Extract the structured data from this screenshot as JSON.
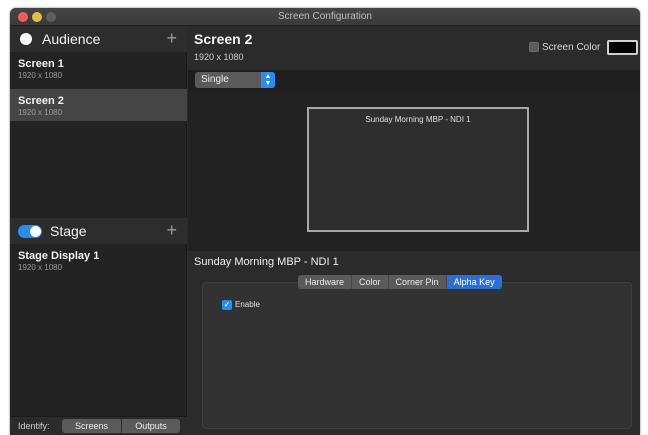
{
  "window": {
    "title": "Screen Configuration"
  },
  "sidebar": {
    "audience": {
      "title": "Audience",
      "items": [
        {
          "name": "Screen 1",
          "resolution": "1920 x 1080"
        },
        {
          "name": "Screen 2",
          "resolution": "1920 x 1080"
        }
      ]
    },
    "stage": {
      "title": "Stage",
      "items": [
        {
          "name": "Stage Display 1",
          "resolution": "1920 x 1080"
        }
      ]
    },
    "identify": {
      "label": "Identify:",
      "screens": "Screens",
      "outputs": "Outputs"
    }
  },
  "main": {
    "title": "Screen 2",
    "resolution": "1920 x 1080",
    "screen_color_label": "Screen Color",
    "screen_color_value": "#000000",
    "mode": "Single",
    "preview_label": "Sunday Morning MBP - NDI 1",
    "output_title": "Sunday Morning MBP - NDI 1",
    "tabs": [
      "Hardware",
      "Color",
      "Corner Pin",
      "Alpha Key"
    ],
    "active_tab": "Alpha Key",
    "enable_label": "Enable"
  }
}
